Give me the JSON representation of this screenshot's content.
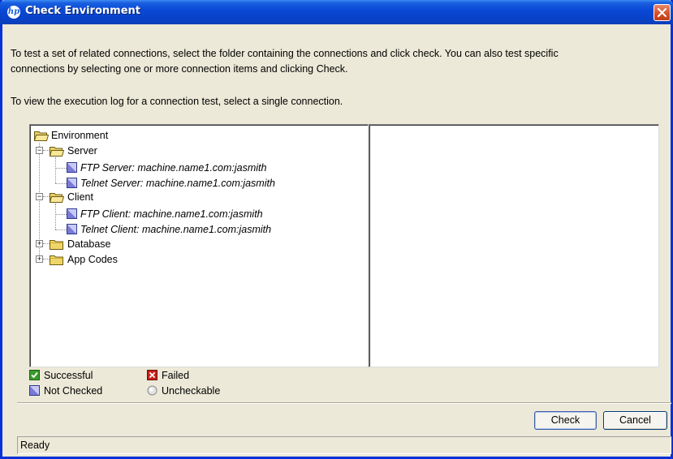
{
  "window": {
    "title": "Check Environment",
    "title_logo": "hp",
    "accent_color": "#0a49d6",
    "close_color": "#d6512b"
  },
  "instructions": {
    "line1": "To test a set of related connections, select the folder containing the connections and click check.  You can also test specific",
    "line2": "connections by selecting one or more connection items and clicking Check.",
    "line3": "To view the execution log for a connection test, select a single connection."
  },
  "tree": {
    "root": {
      "label": "Environment",
      "icon": "folder-open-icon"
    },
    "server": {
      "label": "Server",
      "expanded": true,
      "icon": "folder-open-icon",
      "children": [
        {
          "label": "FTP Server: machine.name1.com:jasmith",
          "status": "not-checked"
        },
        {
          "label": "Telnet Server: machine.name1.com:jasmith",
          "status": "not-checked"
        }
      ]
    },
    "client": {
      "label": "Client",
      "expanded": true,
      "icon": "folder-open-icon",
      "children": [
        {
          "label": "FTP Client: machine.name1.com:jasmith",
          "status": "not-checked"
        },
        {
          "label": "Telnet Client: machine.name1.com:jasmith",
          "status": "not-checked"
        }
      ]
    },
    "database": {
      "label": "Database",
      "expanded": false,
      "icon": "folder-closed-icon"
    },
    "appcodes": {
      "label": "App Codes",
      "expanded": false,
      "icon": "folder-closed-icon"
    }
  },
  "legend": {
    "successful": {
      "label": "Successful",
      "icon": "check-icon",
      "color": "#3a9a2a"
    },
    "failed": {
      "label": "Failed",
      "icon": "x-icon",
      "color": "#c8201a"
    },
    "not_checked": {
      "label": "Not Checked",
      "icon": "not-checked-icon",
      "color": "#7a7ad8"
    },
    "uncheckable": {
      "label": "Uncheckable",
      "icon": "circle-icon",
      "color": "#c0c0c0"
    }
  },
  "buttons": {
    "check": "Check",
    "cancel": "Cancel"
  },
  "status": {
    "text": "Ready"
  }
}
